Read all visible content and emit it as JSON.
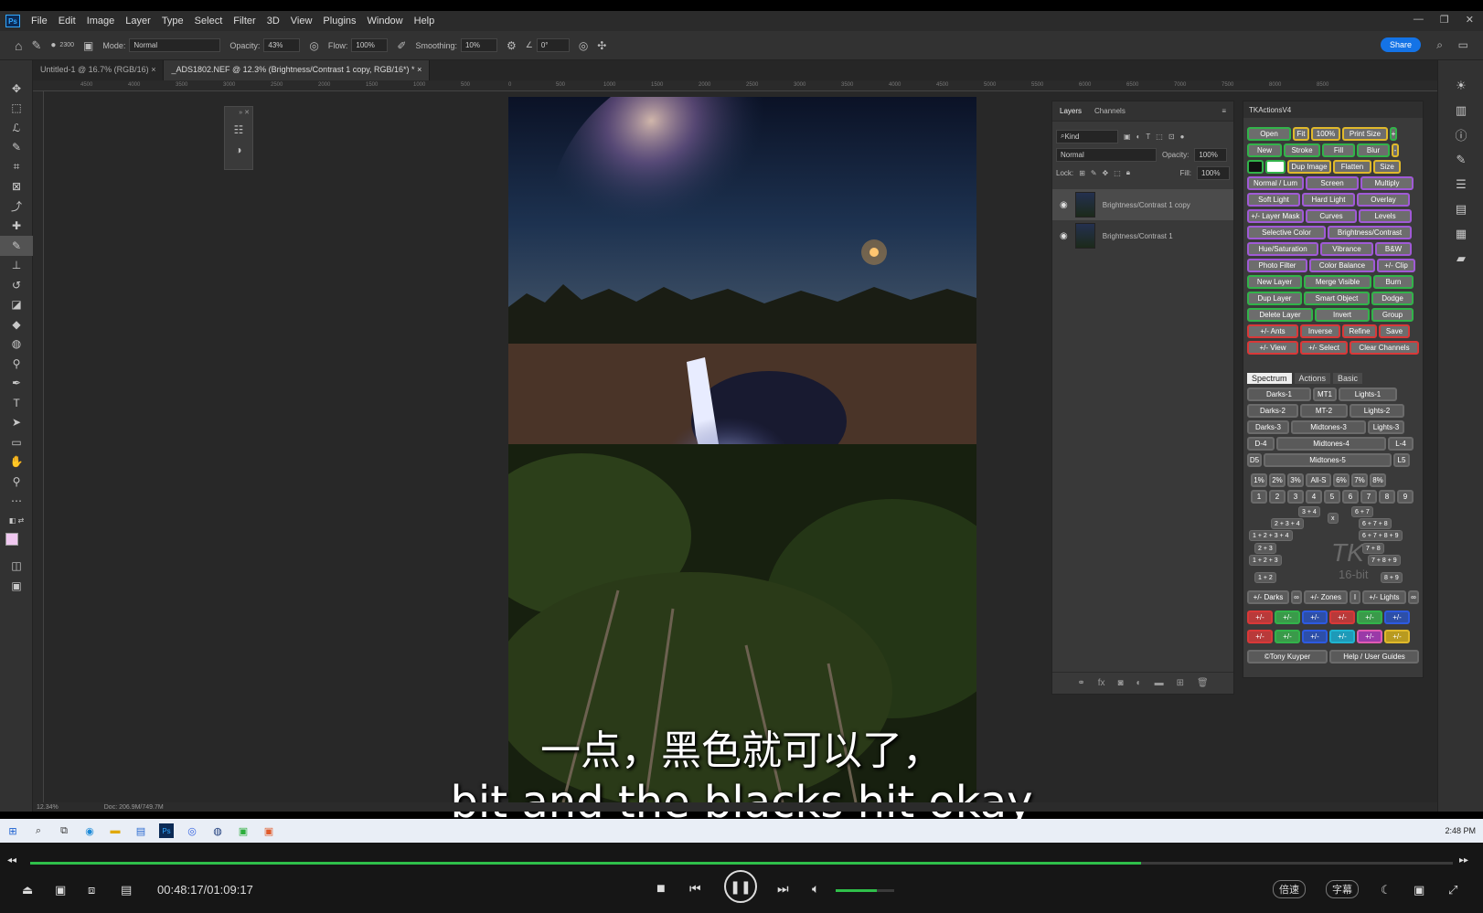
{
  "menu": {
    "items": [
      "File",
      "Edit",
      "Image",
      "Layer",
      "Type",
      "Select",
      "Filter",
      "3D",
      "View",
      "Plugins",
      "Window",
      "Help"
    ],
    "app_badge": "Ps"
  },
  "options": {
    "size": "2300",
    "mode_label": "Mode:",
    "mode": "Normal",
    "opacity_label": "Opacity:",
    "opacity": "43%",
    "flow_label": "Flow:",
    "flow": "100%",
    "smoothing_label": "Smoothing:",
    "smoothing": "10%",
    "angle": "0°",
    "share": "Share"
  },
  "doc_tabs": [
    "Untitled-1 @ 16.7% (RGB/16)",
    "_ADS1802.NEF @ 12.3% (Brightness/Contrast 1 copy, RGB/16*) *"
  ],
  "ruler_ticks": [
    "4500",
    "4000",
    "3500",
    "3000",
    "2500",
    "2000",
    "1500",
    "1000",
    "500",
    "0",
    "500",
    "1000",
    "1500",
    "2000",
    "2500",
    "3000",
    "3500",
    "4000",
    "4500",
    "5000",
    "5500",
    "6000",
    "6500",
    "7000",
    "7500",
    "8000",
    "8500"
  ],
  "status": {
    "zoom": "12.34%",
    "doc": "Doc: 206.9M/749.7M"
  },
  "layers": {
    "tabs": [
      "Layers",
      "Channels"
    ],
    "kind": "Kind",
    "blend": "Normal",
    "opacity_label": "Opacity:",
    "opacity": "100%",
    "lock_label": "Lock:",
    "fill_label": "Fill:",
    "fill": "100%",
    "items": [
      "Brightness/Contrast 1 copy",
      "Brightness/Contrast 1"
    ]
  },
  "tk": {
    "title": "TKActionsV4",
    "rows": [
      [
        "Open",
        "Fit",
        "100%",
        "Print Size",
        "+"
      ],
      [
        "New",
        "Stroke",
        "Fill",
        "Blur",
        "-"
      ],
      [
        "",
        "",
        "Dup Image",
        "Flatten",
        "Size"
      ],
      [
        "Normal / Lum",
        "Screen",
        "Multiply"
      ],
      [
        "Soft Light",
        "Hard Light",
        "Overlay"
      ],
      [
        "+/- Layer Mask",
        "Curves",
        "Levels"
      ],
      [
        "Selective Color",
        "Brightness/Contrast"
      ],
      [
        "Hue/Saturation",
        "Vibrance",
        "B&W"
      ],
      [
        "Photo Filter",
        "Color Balance",
        "+/- Clip"
      ],
      [
        "New Layer",
        "Merge Visible",
        "Burn"
      ],
      [
        "Dup Layer",
        "Smart Object",
        "Dodge"
      ],
      [
        "Delete Layer",
        "Invert",
        "Group"
      ],
      [
        "+/- Ants",
        "Inverse",
        "Refine",
        "Save"
      ],
      [
        "+/- View",
        "+/- Select",
        "Clear Channels"
      ]
    ],
    "tabs": [
      "Spectrum",
      "Actions",
      "Basic"
    ],
    "zones": [
      [
        "Darks-1",
        "MT1",
        "Lights-1"
      ],
      [
        "Darks-2",
        "MT-2",
        "Lights-2"
      ],
      [
        "Darks-3",
        "Midtones-3",
        "Lights-3"
      ],
      [
        "D-4",
        "Midtones-4",
        "L-4"
      ],
      [
        "D5",
        "Midtones-5",
        "L5"
      ]
    ],
    "pct": [
      "1%",
      "2%",
      "3%",
      "All-S",
      "6%",
      "7%",
      "8%"
    ],
    "nums": [
      "1",
      "2",
      "3",
      "4",
      "5",
      "6",
      "7",
      "8",
      "9"
    ],
    "combos": [
      "3 + 4",
      "2 + 3 + 4",
      "1 + 2 + 3 + 4",
      "6 + 7",
      "6 + 7 + 8",
      "6 + 7 + 8 + 9",
      "2 + 3",
      "1 + 2 + 3",
      "1 + 2",
      "7 + 8",
      "7 + 8 + 9",
      "8 + 9",
      "x"
    ],
    "watermark": "TK",
    "watermark2": "16-bit",
    "masks": [
      "+/- Darks",
      "∞",
      "+/- Zones",
      "I",
      "+/- Lights",
      "∞"
    ],
    "pm": "+/-",
    "footer": [
      "©Tony Kuyper",
      "Help / User Guides"
    ]
  },
  "subtitle": {
    "zh": "一点，黑色就可以了，",
    "en": "bit and the blacks hit okay"
  },
  "taskbar": {
    "clock": "2:48 PM"
  },
  "player": {
    "time": "00:48:17/01:09:17",
    "progress": 0.781,
    "volume": 0.7,
    "speed": "倍速",
    "subs": "字幕"
  },
  "colors": {
    "accent": "#31a8ff",
    "progress": "#2fbf4a",
    "share": "#1473e6"
  }
}
